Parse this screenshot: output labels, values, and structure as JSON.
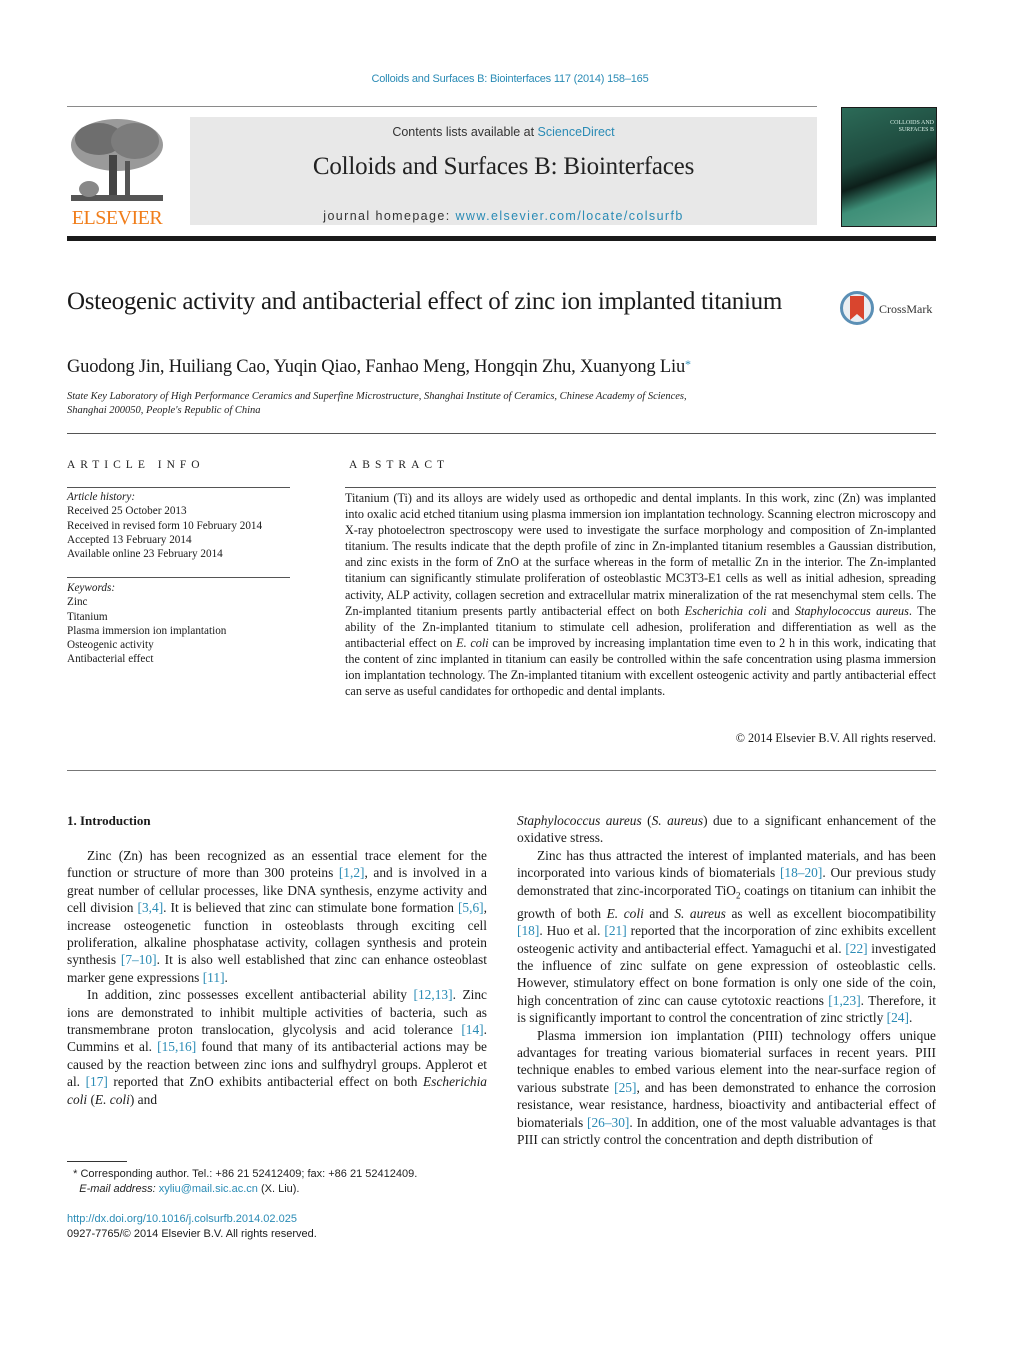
{
  "header": {
    "journal_ref": "Colloids and Surfaces B: Biointerfaces 117 (2014) 158–165",
    "contents_prefix": "Contents lists available at ",
    "contents_link": "ScienceDirect",
    "journal_title": "Colloids and Surfaces B: Biointerfaces",
    "homepage_prefix": "journal homepage: ",
    "homepage_link": "www.elsevier.com/locate/colsurfb",
    "publisher_logo_text": "ELSEVIER",
    "cover_title": "COLLOIDS AND SURFACES B",
    "brand_color": "#f07d1a",
    "link_color": "#2a8bb5"
  },
  "article": {
    "title": "Osteogenic activity and antibacterial effect of zinc ion implanted titanium",
    "crossmark_label": "CrossMark",
    "authors": "Guodong Jin, Huiliang Cao, Yuqin Qiao, Fanhao Meng, Hongqin Zhu, Xuanyong Liu",
    "corresponding_mark": "*",
    "affiliation_line1": "State Key Laboratory of High Performance Ceramics and Superfine Microstructure, Shanghai Institute of Ceramics, Chinese Academy of Sciences,",
    "affiliation_line2": "Shanghai 200050, People's Republic of China"
  },
  "article_info": {
    "heading": "ARTICLE INFO",
    "history_label": "Article history:",
    "history": [
      "Received 25 October 2013",
      "Received in revised form 10 February 2014",
      "Accepted 13 February 2014",
      "Available online 23 February 2014"
    ],
    "keywords_label": "Keywords:",
    "keywords": [
      "Zinc",
      "Titanium",
      "Plasma immersion ion implantation",
      "Osteogenic activity",
      "Antibacterial effect"
    ]
  },
  "abstract": {
    "heading": "ABSTRACT",
    "part1": "Titanium (Ti) and its alloys are widely used as orthopedic and dental implants. In this work, zinc (Zn) was implanted into oxalic acid etched titanium using plasma immersion ion implantation technology. Scanning electron microscopy and X-ray photoelectron spectroscopy were used to investigate the surface morphology and composition of Zn-implanted titanium. The results indicate that the depth profile of zinc in Zn-implanted titanium resembles a Gaussian distribution, and zinc exists in the form of ZnO at the surface whereas in the form of metallic Zn in the interior. The Zn-implanted titanium can significantly stimulate proliferation of osteoblastic MC3T3-E1 cells as well as initial adhesion, spreading activity, ALP activity, collagen secretion and extracellular matrix mineralization of the rat mesenchymal stem cells. The Zn-implanted titanium presents partly antibacterial effect on both ",
    "ital1": "Escherichia coli",
    "part2": " and ",
    "ital2": "Staphylococcus aureus",
    "part3": ". The ability of the Zn-implanted titanium to stimulate cell adhesion, proliferation and differentiation as well as the antibacterial effect on ",
    "ital3": "E. coli",
    "part4": " can be improved by increasing implantation time even to 2 h in this work, indicating that the content of zinc implanted in titanium can easily be controlled within the safe concentration using plasma immersion ion implantation technology. The Zn-implanted titanium with excellent osteogenic activity and partly antibacterial effect can serve as useful candidates for orthopedic and dental implants.",
    "copyright": "© 2014 Elsevier B.V. All rights reserved."
  },
  "introduction": {
    "heading": "1.  Introduction",
    "left": {
      "p1_a": "Zinc (Zn) has been recognized as an essential trace element for the function or structure of more than 300 proteins ",
      "ref1": "[1,2]",
      "p1_b": ", and is involved in a great number of cellular processes, like DNA synthesis, enzyme activity and cell division ",
      "ref2": "[3,4]",
      "p1_c": ". It is believed that zinc can stimulate bone formation ",
      "ref3": "[5,6]",
      "p1_d": ", increase osteogenetic function in osteoblasts through exciting cell proliferation, alkaline phosphatase activity, collagen synthesis and protein synthesis ",
      "ref4": "[7–10]",
      "p1_e": ". It is also well established that zinc can enhance osteoblast marker gene expressions ",
      "ref5": "[11]",
      "p1_f": ".",
      "p2_a": "In addition, zinc possesses excellent antibacterial ability ",
      "ref6": "[12,13]",
      "p2_b": ". Zinc ions are demonstrated to inhibit multiple activities of bacteria, such as transmembrane proton translocation, glycolysis and acid tolerance ",
      "ref7": "[14]",
      "p2_c": ". Cummins et al. ",
      "ref8": "[15,16]",
      "p2_d": " found that many of its antibacterial actions may be caused by the reaction between zinc ions and sulfhydryl groups. Applerot et al. ",
      "ref9": "[17]",
      "p2_e": " reported that ZnO exhibits antibacterial effect on both ",
      "ital_a": "Escherichia coli",
      "p2_f": " (",
      "ital_b": "E. coli",
      "p2_g": ") and"
    },
    "right": {
      "ital_a": "Staphylococcus aureus",
      "p0_a": " (",
      "ital_b": "S. aureus",
      "p0_b": ") due to a significant enhancement of the oxidative stress.",
      "p1_a": "Zinc has thus attracted the interest of implanted materials, and has been incorporated into various kinds of biomaterials ",
      "ref1": "[18–20]",
      "p1_b": ". Our previous study demonstrated that zinc-incorporated TiO",
      "sub": "2",
      "p1_c": " coatings on titanium can inhibit the growth of both ",
      "ital_c": "E. coli",
      "p1_d": " and ",
      "ital_d": "S. aureus",
      "p1_e": " as well as excellent biocompatibility ",
      "ref2": "[18]",
      "p1_f": ". Huo et al. ",
      "ref3": "[21]",
      "p1_g": " reported that the incorporation of zinc exhibits excellent osteogenic activity and antibacterial effect. Yamaguchi et al. ",
      "ref4": "[22]",
      "p1_h": " investigated the influence of zinc sulfate on gene expression of osteoblastic cells. However, stimulatory effect on bone formation is only one side of the coin, high concentration of zinc can cause cytotoxic reactions ",
      "ref5": "[1,23]",
      "p1_i": ". Therefore, it is significantly important to control the concentration of zinc strictly ",
      "ref6": "[24]",
      "p1_j": ".",
      "p2_a": "Plasma immersion ion implantation (PIII) technology offers unique advantages for treating various biomaterial surfaces in recent years. PIII technique enables to embed various element into the near-surface region of various substrate ",
      "ref7": "[25]",
      "p2_b": ", and has been demonstrated to enhance the corrosion resistance, wear resistance, hardness, bioactivity and antibacterial effect of biomaterials ",
      "ref8": "[26–30]",
      "p2_c": ". In addition, one of the most valuable advantages is that PIII can strictly control the concentration and depth distribution of"
    }
  },
  "footnote": {
    "mark": "*",
    "corresponding": " Corresponding author. Tel.: +86 21 52412409; fax: +86 21 52412409.",
    "email_label": "E-mail address:",
    "email": "xyliu@mail.sic.ac.cn",
    "email_suffix": " (X. Liu).",
    "doi": "http://dx.doi.org/10.1016/j.colsurfb.2014.02.025",
    "issn_line": "0927-7765/© 2014 Elsevier B.V. All rights reserved."
  }
}
